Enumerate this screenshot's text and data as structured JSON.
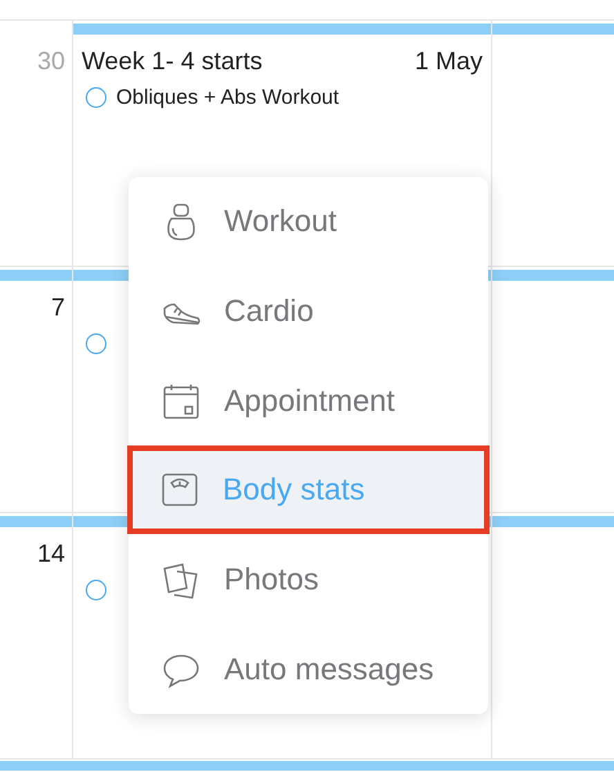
{
  "weeks": [
    {
      "day": "30",
      "other_month": true,
      "title": "Week 1- 4 starts",
      "date": "1 May",
      "events": [
        {
          "label": "Obliques + Abs Workout",
          "done": false
        }
      ]
    },
    {
      "day": "7",
      "other_month": false,
      "events": [
        {
          "done": false
        }
      ]
    },
    {
      "day": "14",
      "other_month": false,
      "events": [
        {
          "done": false
        }
      ]
    }
  ],
  "menu": {
    "items": [
      {
        "kind": "workout",
        "label": "Workout",
        "selected": false,
        "highlighted": false
      },
      {
        "kind": "cardio",
        "label": "Cardio",
        "selected": false,
        "highlighted": false
      },
      {
        "kind": "appointment",
        "label": "Appointment",
        "selected": false,
        "highlighted": false
      },
      {
        "kind": "body_stats",
        "label": "Body stats",
        "selected": true,
        "highlighted": true
      },
      {
        "kind": "photos",
        "label": "Photos",
        "selected": false,
        "highlighted": false
      },
      {
        "kind": "messages",
        "label": "Auto messages",
        "selected": false,
        "highlighted": false
      }
    ]
  }
}
